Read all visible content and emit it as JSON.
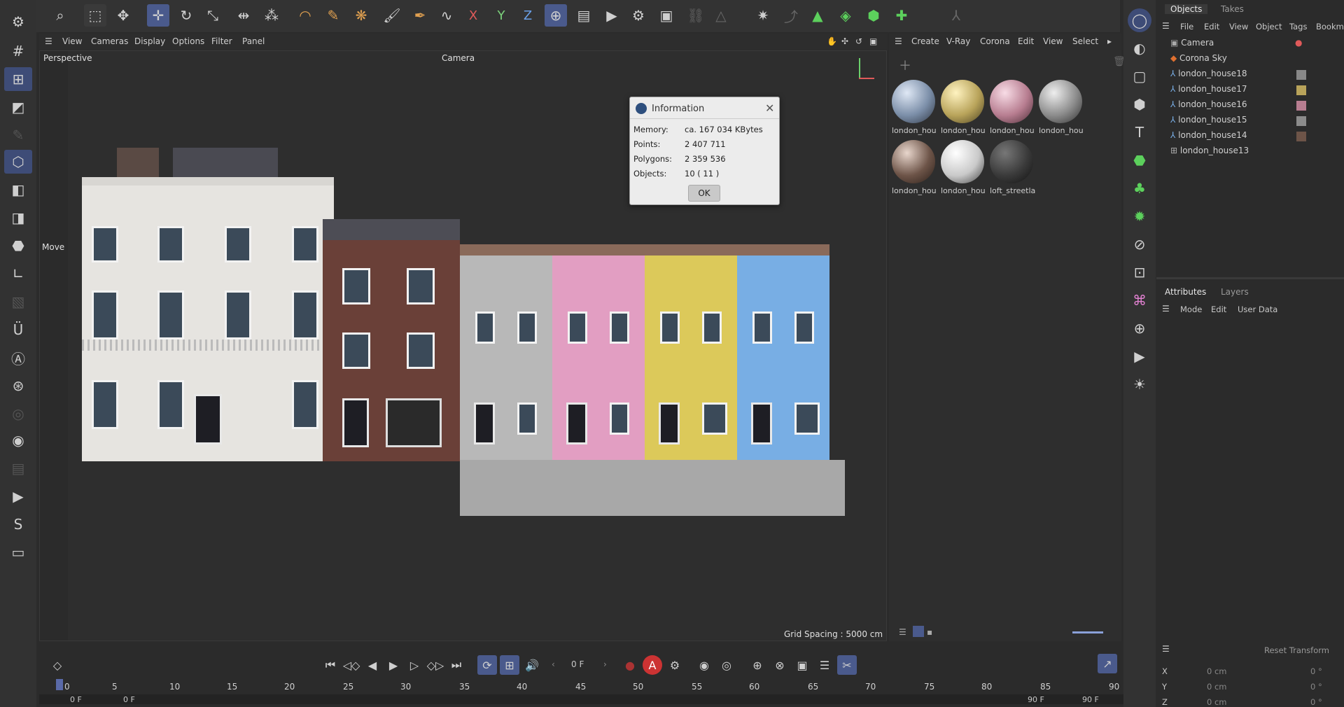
{
  "toolbar": {
    "tools": [
      "search-icon",
      "live-select-icon",
      "selection-icon",
      "move-icon",
      "rotate-icon",
      "scale-icon",
      "transform-icon",
      "snap-icon",
      "bend-icon",
      "paint-icon",
      "sculpt-icon",
      "brush-icon",
      "pen-icon",
      "spline-icon",
      "axis-x",
      "axis-y",
      "axis-z",
      "world-coords-icon",
      "render-view-icon",
      "render-icon",
      "render-settings-icon",
      "render-queue-icon"
    ],
    "axis_x": "X",
    "axis_y": "Y",
    "axis_z": "Z"
  },
  "viewport": {
    "menu": [
      "View",
      "Cameras",
      "Display",
      "Options",
      "Filter",
      "Panel"
    ],
    "label": "Perspective",
    "camera": "Camera",
    "grid_spacing": "Grid Spacing : 5000 cm",
    "tool_label": "Move"
  },
  "materials": {
    "menu": [
      "Create",
      "V-Ray",
      "Corona",
      "Edit",
      "View",
      "Select"
    ],
    "items": [
      {
        "name": "london_hou",
        "color": "#7b8ea8"
      },
      {
        "name": "london_hou",
        "color": "#b8a35a"
      },
      {
        "name": "london_hou",
        "color": "#b77d90"
      },
      {
        "name": "london_hou",
        "color": "#8b8b8b"
      },
      {
        "name": "london_hou",
        "color": "#6d5448"
      },
      {
        "name": "london_hou",
        "color": "#c9c9c9"
      },
      {
        "name": "loft_streetla",
        "color": "#3a3a3a"
      }
    ]
  },
  "objects": {
    "tabs": [
      "Objects",
      "Takes"
    ],
    "menu": [
      "File",
      "Edit",
      "View",
      "Object",
      "Tags",
      "Bookm"
    ],
    "rows": [
      "Camera",
      "Corona Sky",
      "london_house18",
      "london_house17",
      "london_house16",
      "london_house15",
      "london_house14",
      "london_house13"
    ]
  },
  "attributes": {
    "tabs": [
      "Attributes",
      "Layers"
    ],
    "menu": [
      "Mode",
      "Edit",
      "User Data"
    ]
  },
  "coords": {
    "reset": "Reset Transform",
    "rows": [
      {
        "axis": "X",
        "pos": "0 cm",
        "rot": "0 °"
      },
      {
        "axis": "Y",
        "pos": "0 cm",
        "rot": "0 °"
      },
      {
        "axis": "Z",
        "pos": "0 cm",
        "rot": "0 °"
      }
    ]
  },
  "timeline": {
    "frame": "0 F",
    "ticks": [
      "0",
      "5",
      "10",
      "15",
      "20",
      "25",
      "30",
      "35",
      "40",
      "45",
      "50",
      "55",
      "60",
      "65",
      "70",
      "75",
      "80",
      "85",
      "90"
    ],
    "start": "0 F",
    "start2": "0 F",
    "end": "90 F",
    "end2": "90 F"
  },
  "dialog": {
    "title": "Information",
    "rows": [
      {
        "label": "Memory:",
        "value": "ca. 167 034 KBytes"
      },
      {
        "label": "Points:",
        "value": "2 407 711"
      },
      {
        "label": "Polygons:",
        "value": "2 359 536"
      },
      {
        "label": "Objects:",
        "value": "10 ( 11 )"
      }
    ],
    "ok": "OK"
  }
}
